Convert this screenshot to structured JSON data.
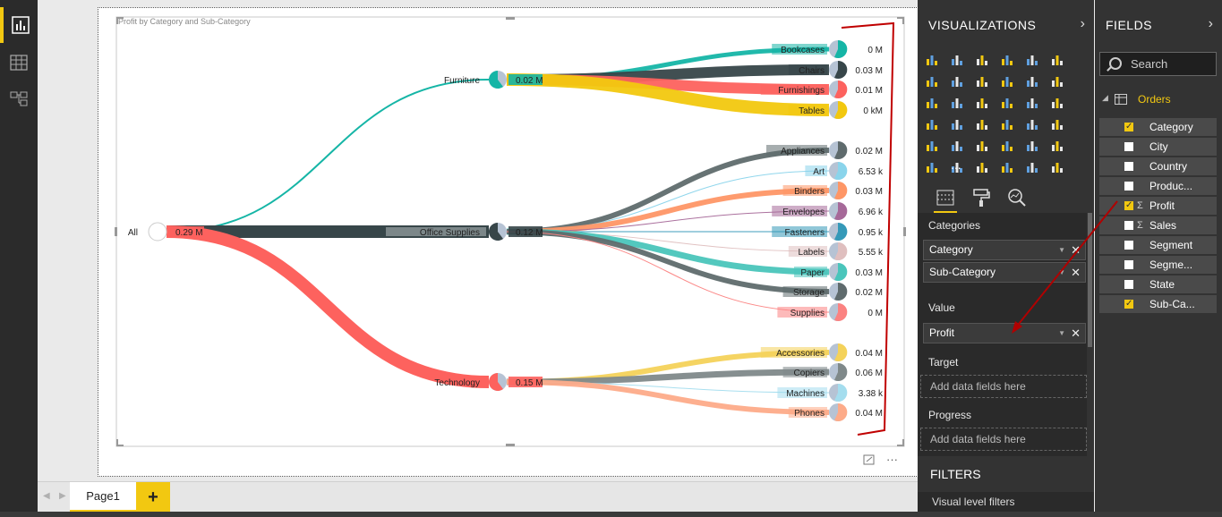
{
  "report": {
    "page_tab": "Page1",
    "add_tab": "+"
  },
  "visual": {
    "title": "Profit by Category and Sub-Category"
  },
  "tree": {
    "root": {
      "label": "All",
      "value": "0.29 M"
    },
    "categories": [
      {
        "label": "Furniture",
        "value": "0.02 M",
        "color": "#15b5a6"
      },
      {
        "label": "Office Supplies",
        "value": "0.12 M",
        "color": "#374649"
      },
      {
        "label": "Technology",
        "value": "0.15 M",
        "color": "#fd625e"
      }
    ],
    "subcategories": [
      {
        "label": "Bookcases",
        "value": "0 M",
        "color": "#15b5a6",
        "parent": 0
      },
      {
        "label": "Chairs",
        "value": "0.03 M",
        "color": "#374649",
        "parent": 0
      },
      {
        "label": "Furnishings",
        "value": "0.01 M",
        "color": "#fd625e",
        "parent": 0
      },
      {
        "label": "Tables",
        "value": "0 kM",
        "color": "#f2c80f",
        "parent": 0
      },
      {
        "label": "Appliances",
        "value": "0.02 M",
        "color": "#5f6b6d",
        "parent": 1
      },
      {
        "label": "Art",
        "value": "6.53 k",
        "color": "#8ad4eb",
        "parent": 1
      },
      {
        "label": "Binders",
        "value": "0.03 M",
        "color": "#fe9666",
        "parent": 1
      },
      {
        "label": "Envelopes",
        "value": "6.96 k",
        "color": "#a66999",
        "parent": 1
      },
      {
        "label": "Fasteners",
        "value": "0.95 k",
        "color": "#3599b8",
        "parent": 1
      },
      {
        "label": "Labels",
        "value": "5.55 k",
        "color": "#dfbfbf",
        "parent": 1
      },
      {
        "label": "Paper",
        "value": "0.03 M",
        "color": "#4ac5bb",
        "parent": 1
      },
      {
        "label": "Storage",
        "value": "0.02 M",
        "color": "#5f6b6d",
        "parent": 1
      },
      {
        "label": "Supplies",
        "value": "0 M",
        "color": "#fb8281",
        "parent": 1
      },
      {
        "label": "Accessories",
        "value": "0.04 M",
        "color": "#f4d25a",
        "parent": 2
      },
      {
        "label": "Copiers",
        "value": "0.06 M",
        "color": "#7f898a",
        "parent": 2
      },
      {
        "label": "Machines",
        "value": "3.38 k",
        "color": "#a4ddee",
        "parent": 2
      },
      {
        "label": "Phones",
        "value": "0.04 M",
        "color": "#fdab89",
        "parent": 2
      }
    ]
  },
  "visualizations_pane": {
    "title": "VISUALIZATIONS",
    "more": "...",
    "wells": {
      "categories_label": "Categories",
      "category_field": "Category",
      "subcategory_field": "Sub-Category",
      "value_label": "Value",
      "value_field": "Profit",
      "target_label": "Target",
      "target_placeholder": "Add data fields here",
      "progress_label": "Progress",
      "progress_placeholder": "Add data fields here"
    },
    "filters_title": "FILTERS",
    "visual_filters": "Visual level filters"
  },
  "fields_pane": {
    "title": "FIELDS",
    "search_placeholder": "Search",
    "table_name": "Orders",
    "fields": [
      {
        "name": "Category",
        "checked": true,
        "sigma": false
      },
      {
        "name": "City",
        "checked": false,
        "sigma": false
      },
      {
        "name": "Country",
        "checked": false,
        "sigma": false
      },
      {
        "name": "Produc...",
        "checked": false,
        "sigma": false
      },
      {
        "name": "Profit",
        "checked": true,
        "sigma": true
      },
      {
        "name": "Sales",
        "checked": false,
        "sigma": true
      },
      {
        "name": "Segment",
        "checked": false,
        "sigma": false
      },
      {
        "name": "Segme...",
        "checked": false,
        "sigma": false
      },
      {
        "name": "State",
        "checked": false,
        "sigma": false
      },
      {
        "name": "Sub-Ca...",
        "checked": true,
        "sigma": false
      }
    ]
  },
  "colors": {
    "accent": "#f2c811",
    "annotation": "#c00000"
  }
}
